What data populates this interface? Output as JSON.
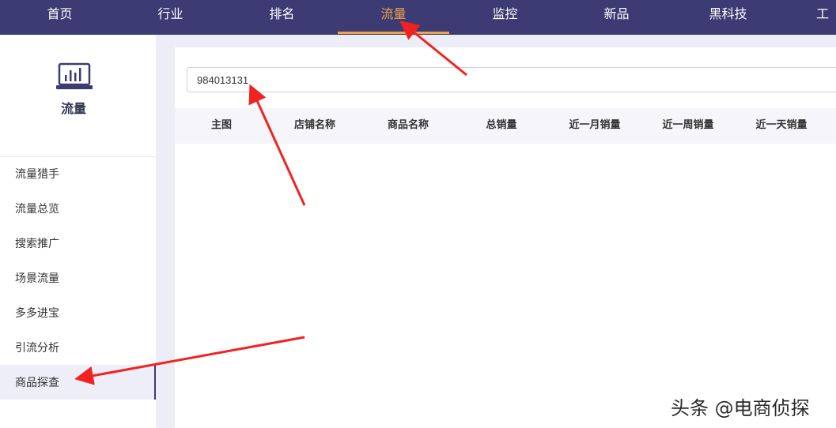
{
  "topnav": {
    "items": [
      {
        "label": "首页"
      },
      {
        "label": "行业"
      },
      {
        "label": "排名"
      },
      {
        "label": "流量"
      },
      {
        "label": "监控"
      },
      {
        "label": "新品"
      },
      {
        "label": "黑科技"
      },
      {
        "label": "工"
      }
    ],
    "active_index": 3,
    "background_color": "#3c3b73",
    "active_color": "#f0a24a"
  },
  "sidebar": {
    "title": "流量",
    "icon": "chart-monitor-icon",
    "items": [
      {
        "label": "流量猎手"
      },
      {
        "label": "流量总览"
      },
      {
        "label": "搜索推广"
      },
      {
        "label": "场景流量"
      },
      {
        "label": "多多进宝"
      },
      {
        "label": "引流分析"
      },
      {
        "label": "商品探查"
      }
    ],
    "active_index": 6
  },
  "search": {
    "value": "984013131"
  },
  "table": {
    "columns": [
      "主图",
      "店铺名称",
      "商品名称",
      "总销量",
      "近一月销量",
      "近一周销量",
      "近一天销量"
    ]
  },
  "watermark": {
    "text": "头条 @电商侦探"
  },
  "annotation_color": "#f22222"
}
